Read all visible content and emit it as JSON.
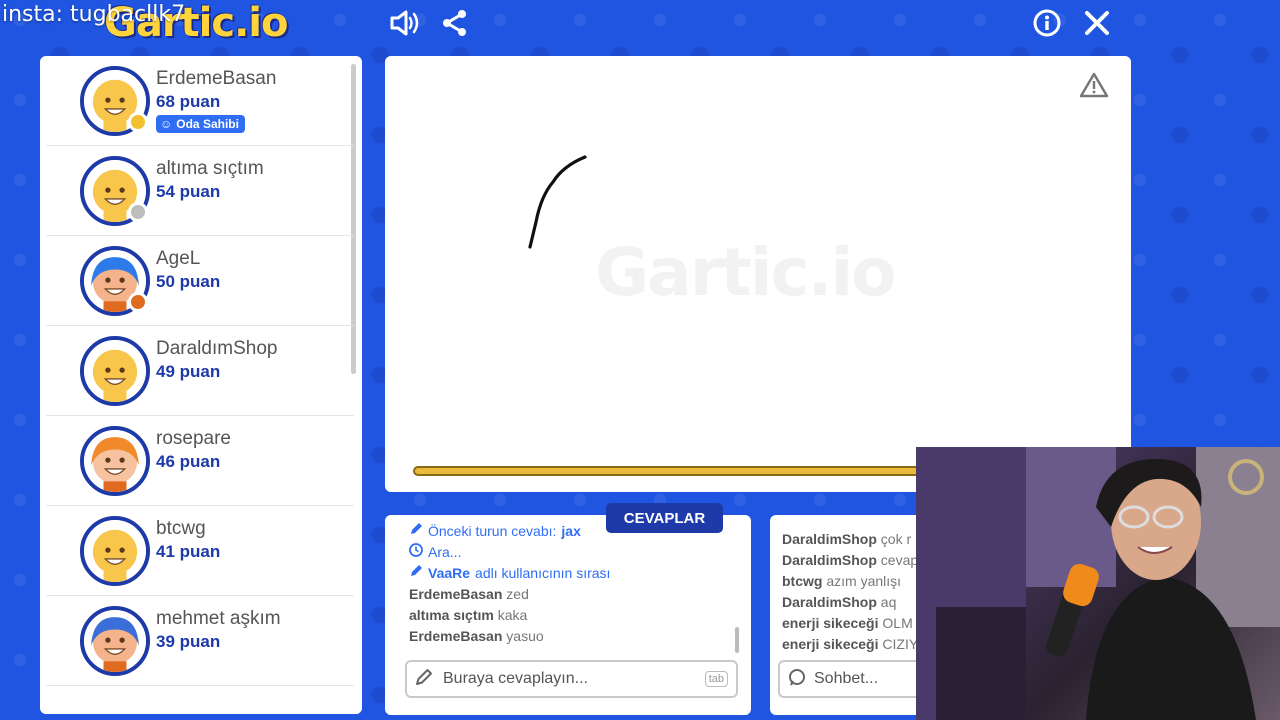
{
  "overlay": {
    "text": "insta: tugbacllk7"
  },
  "header": {
    "logo": "Gartic.io"
  },
  "players": [
    {
      "name": "ErdemeBasan",
      "score": "68 puan",
      "badge": "Oda Sahibi",
      "dot": "#f2c12e",
      "skin": "#f7c64a",
      "hair": "none"
    },
    {
      "name": "altıma sıçtım",
      "score": "54 puan",
      "dot": "#bdbdbd",
      "skin": "#f7c64a",
      "hair": "none"
    },
    {
      "name": "AgeL",
      "score": "50 puan",
      "dot": "#e06a20",
      "skin": "#f4b38a",
      "hair": "#2d7be8"
    },
    {
      "name": "DaraldımShop",
      "score": "49 puan",
      "skin": "#f7c64a",
      "hair": "none"
    },
    {
      "name": "rosepare",
      "score": "46 puan",
      "skin": "#f6c2a0",
      "hair": "#f08a2a"
    },
    {
      "name": "btcwg",
      "score": "41 puan",
      "skin": "#f7c64a",
      "hair": "none"
    },
    {
      "name": "mehmet aşkım",
      "score": "39 puan",
      "skin": "#f4b38a",
      "hair": "#3a6ed8"
    }
  ],
  "canvas": {
    "watermark": "Gartic.io"
  },
  "answers": {
    "tab_label": "CEVAPLAR",
    "prev_answer_label": "Önceki turun cevabı:",
    "prev_answer_value": "jax",
    "searching": "Ara...",
    "turn_user": "VaaRe",
    "turn_text": "adlı kullanıcının sırası",
    "messages": [
      {
        "user": "ErdemeBasan",
        "text": "zed"
      },
      {
        "user": "altıma sıçtım",
        "text": "kaka"
      },
      {
        "user": "ErdemeBasan",
        "text": "yasuo"
      }
    ],
    "input_placeholder": "Buraya cevaplayın...",
    "tab_key": "tab"
  },
  "chat": {
    "messages": [
      {
        "user": "DaraldimShop",
        "text": "çok r"
      },
      {
        "user": "DaraldimShop",
        "text": "cevap"
      },
      {
        "user": "btcwg",
        "text": "azım yanlışı"
      },
      {
        "user": "DaraldimShop",
        "text": "aq"
      },
      {
        "user": "enerji sikeceği",
        "text": "OLM"
      },
      {
        "user": "enerji sikeceği",
        "text": "CIZIY"
      }
    ],
    "input_placeholder": "Sohbet..."
  },
  "colors": {
    "brand_blue": "#1d3aa8",
    "accent_yellow": "#f2c12e",
    "bg_blue": "#1f55e0"
  }
}
